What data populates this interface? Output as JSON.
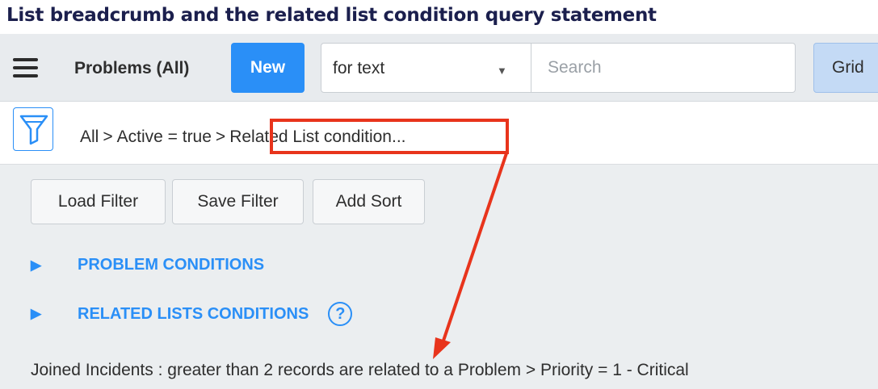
{
  "caption": "List breadcrumb and the related list condition query statement",
  "header": {
    "list_title": "Problems (All)",
    "new_label": "New",
    "search_field_select": "for text",
    "search_placeholder": "Search",
    "view_label": "Grid"
  },
  "breadcrumb": {
    "items": [
      "All",
      "Active = true",
      "Related List condition..."
    ],
    "separator": ">"
  },
  "filter_buttons": [
    "Load Filter",
    "Save Filter",
    "Add Sort"
  ],
  "sections": [
    "PROBLEM CONDITIONS",
    "RELATED LISTS CONDITIONS"
  ],
  "help_label": "?",
  "condition_statement": "Joined Incidents : greater than 2 records are related to a Problem  > Priority = 1 - Critical",
  "icons": {
    "menu": "hamburger-menu-icon",
    "filter": "funnel-filter-icon",
    "expand": "triangle-right-icon",
    "help": "question-circle-icon",
    "dropdown": "triangle-down-icon"
  },
  "colors": {
    "accent": "#2a8ff7",
    "annotation": "#e8341c",
    "caption": "#1b1f4d",
    "header_bg": "#e8ebee",
    "panel_bg": "#ebeef0"
  }
}
